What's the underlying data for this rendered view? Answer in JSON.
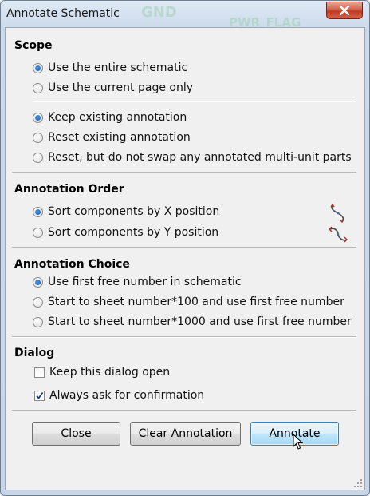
{
  "window": {
    "title": "Annotate Schematic"
  },
  "scope": {
    "title": "Scope",
    "range_options": [
      "Use the entire schematic",
      "Use the current page only"
    ],
    "range_selected": 0,
    "annotation_options": [
      "Keep existing annotation",
      "Reset existing annotation",
      "Reset, but do not swap any annotated multi-unit parts"
    ],
    "annotation_selected": 0
  },
  "order": {
    "title": "Annotation Order",
    "options": [
      "Sort components by X position",
      "Sort components by Y position"
    ],
    "selected": 0,
    "icons": [
      "sort-x-icon",
      "sort-y-icon"
    ]
  },
  "choice": {
    "title": "Annotation Choice",
    "options": [
      "Use first free number in schematic",
      "Start to  sheet number*100 and use first free number",
      "Start to  sheet number*1000 and use first free number"
    ],
    "selected": 0
  },
  "dialog": {
    "title": "Dialog",
    "keep_open_label": "Keep this dialog open",
    "keep_open_checked": false,
    "always_ask_label": "Always ask for confirmation",
    "always_ask_checked": true
  },
  "buttons": {
    "close": "Close",
    "clear": "Clear Annotation",
    "annotate": "Annotate"
  },
  "background_text": [
    "GND",
    "PWR_FLAG"
  ]
}
